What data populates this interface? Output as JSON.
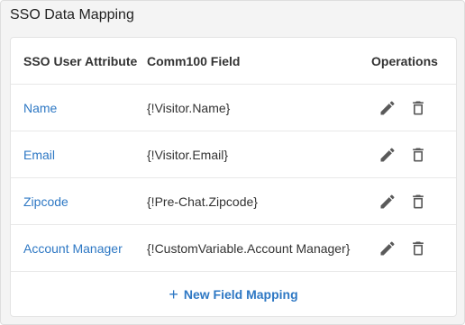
{
  "panel": {
    "title": "SSO Data Mapping"
  },
  "table": {
    "headers": {
      "attribute": "SSO User Attribute",
      "field": "Comm100 Field",
      "operations": "Operations"
    },
    "rows": [
      {
        "attribute": "Name",
        "field": "{!Visitor.Name}"
      },
      {
        "attribute": "Email",
        "field": "{!Visitor.Email}"
      },
      {
        "attribute": "Zipcode",
        "field": "{!Pre-Chat.Zipcode}"
      },
      {
        "attribute": "Account Manager",
        "field": "{!CustomVariable.Account Manager}"
      }
    ]
  },
  "actions": {
    "add_icon": "+",
    "add_label": "New Field Mapping"
  },
  "icons": {
    "edit": "pencil-icon",
    "delete": "trash-icon"
  },
  "colors": {
    "link": "#2e78c4",
    "icon": "#5a5a5a"
  }
}
